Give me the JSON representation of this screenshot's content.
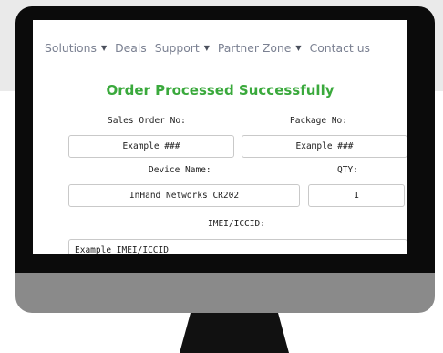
{
  "nav": {
    "items": [
      {
        "label": "Solutions",
        "has_dropdown": true
      },
      {
        "label": "Deals",
        "has_dropdown": false
      },
      {
        "label": "Support",
        "has_dropdown": true
      },
      {
        "label": "Partner Zone",
        "has_dropdown": true
      },
      {
        "label": "Contact us",
        "has_dropdown": false
      }
    ],
    "caret": "▼"
  },
  "page": {
    "title": "Order Processed Successfully"
  },
  "form": {
    "sales_order_label": "Sales Order No:",
    "sales_order_value": "Example ###",
    "package_label": "Package No:",
    "package_value": "Example ###",
    "device_name_label": "Device Name:",
    "device_name_value": "InHand Networks CR202",
    "qty_label": "QTY:",
    "qty_value": "1",
    "imei_label": "IMEI/ICCID:",
    "imei_value": "Example IMEI/ICCID"
  },
  "colors": {
    "title_green": "#3aa93c",
    "nav_text": "#7b8192",
    "bezel": "#0b0b0b",
    "chin": "#8a8a8a"
  }
}
